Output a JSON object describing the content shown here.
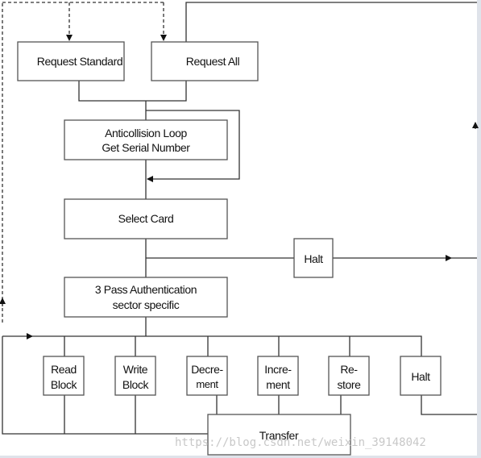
{
  "boxes": {
    "request_standard": "Request Standard",
    "request_all": "Request All",
    "anticollision": [
      "Anticollision Loop",
      "Get Serial Number"
    ],
    "select_card": "Select Card",
    "halt_top": "Halt",
    "authentication": [
      "3 Pass Authentication",
      "sector specific"
    ],
    "read_block": [
      "Read",
      "Block"
    ],
    "write_block": [
      "Write",
      "Block"
    ],
    "decrement": [
      "Decre-",
      "ment"
    ],
    "increment": [
      "Incre-",
      "ment"
    ],
    "restore": [
      "Re-",
      "store"
    ],
    "halt_bottom": "Halt",
    "transfer": "Transfer"
  },
  "watermark": "https://blog.csdn.net/weixin_39148042",
  "colors": {
    "line": "#333333",
    "box_border": "#555555",
    "background": "#ffffff",
    "frame": "#dfe3ea"
  }
}
